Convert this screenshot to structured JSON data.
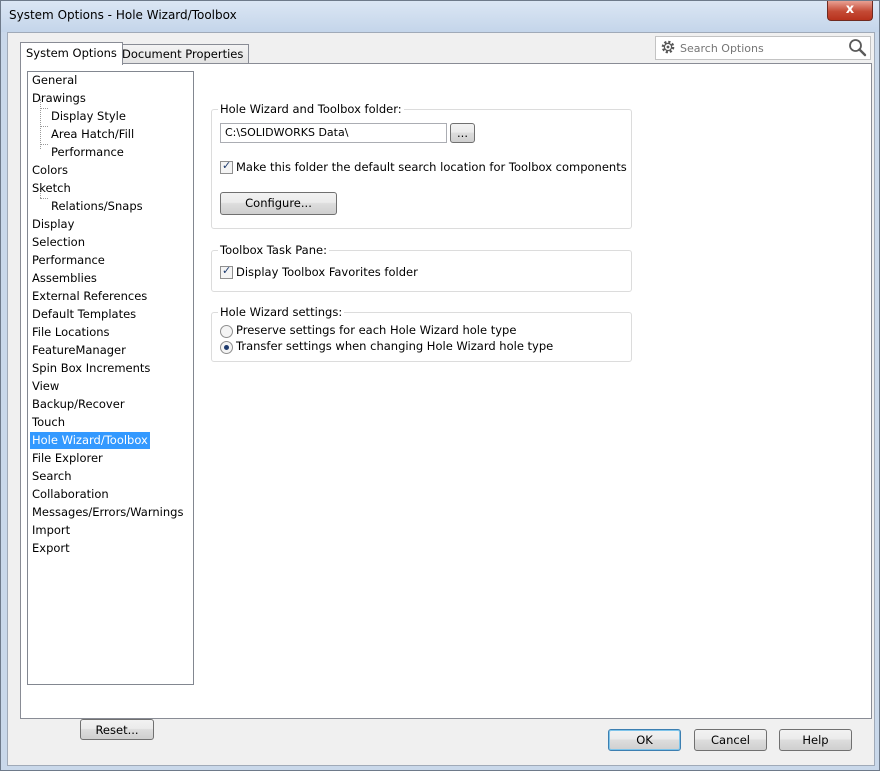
{
  "window": {
    "title": "System Options - Hole Wizard/Toolbox",
    "close_label": "x"
  },
  "tabs": [
    {
      "label": "System Options"
    },
    {
      "label": "Document Properties"
    }
  ],
  "search": {
    "placeholder": "Search Options",
    "icon": "magnifier-icon",
    "options_icon": "gear-icon"
  },
  "tree": {
    "selected": "Hole Wizard/Toolbox",
    "items": [
      {
        "label": "General"
      },
      {
        "label": "Drawings"
      },
      {
        "label": "Display Style"
      },
      {
        "label": "Area Hatch/Fill"
      },
      {
        "label": "Performance"
      },
      {
        "label": "Colors"
      },
      {
        "label": "Sketch"
      },
      {
        "label": "Relations/Snaps"
      },
      {
        "label": "Display"
      },
      {
        "label": "Selection"
      },
      {
        "label": "Performance"
      },
      {
        "label": "Assemblies"
      },
      {
        "label": "External References"
      },
      {
        "label": "Default Templates"
      },
      {
        "label": "File Locations"
      },
      {
        "label": "FeatureManager"
      },
      {
        "label": "Spin Box Increments"
      },
      {
        "label": "View"
      },
      {
        "label": "Backup/Recover"
      },
      {
        "label": "Touch"
      },
      {
        "label": "Hole Wizard/Toolbox"
      },
      {
        "label": "File Explorer"
      },
      {
        "label": "Search"
      },
      {
        "label": "Collaboration"
      },
      {
        "label": "Messages/Errors/Warnings"
      },
      {
        "label": "Import"
      },
      {
        "label": "Export"
      }
    ]
  },
  "reset_label": "Reset...",
  "folder_group": {
    "title": "Hole Wizard and Toolbox folder:",
    "path_value": "C:\\SOLIDWORKS Data\\",
    "browse_label": "...",
    "default_search_checkbox": {
      "label": "Make this folder the default search location for Toolbox components",
      "checked": true
    },
    "configure_label": "Configure..."
  },
  "task_pane_group": {
    "title": "Toolbox Task Pane:",
    "favorites_checkbox": {
      "label": "Display Toolbox Favorites folder",
      "checked": true
    }
  },
  "hole_wizard_group": {
    "title": "Hole Wizard settings:",
    "options": [
      {
        "label": "Preserve settings for each Hole Wizard hole type",
        "selected": false
      },
      {
        "label": "Transfer settings when changing Hole Wizard hole type",
        "selected": true
      }
    ]
  },
  "footer": {
    "ok_label": "OK",
    "cancel_label": "Cancel",
    "help_label": "Help"
  },
  "colors": {
    "selection": "#3399ff",
    "title_bar": "#c4d5ea",
    "close_button": "#c44a35"
  }
}
